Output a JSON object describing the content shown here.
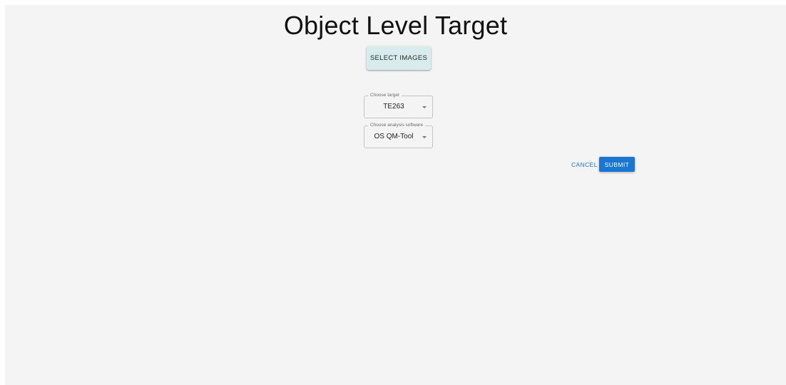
{
  "page": {
    "title": "Object Level Target"
  },
  "actions": {
    "select_images_label": "SELECT IMAGES",
    "cancel_label": "CANCEL",
    "submit_label": "SUBMIT"
  },
  "form": {
    "target": {
      "label": "Choose target",
      "value": "TE263"
    },
    "software": {
      "label": "Choose analysis software",
      "value": "OS QM-Tool"
    }
  },
  "colors": {
    "background": "#f4f4f4",
    "primary": "#1976d2",
    "select_images_button": "#d8ecee"
  },
  "icons": {
    "dropdown": "chevron-down-icon"
  }
}
